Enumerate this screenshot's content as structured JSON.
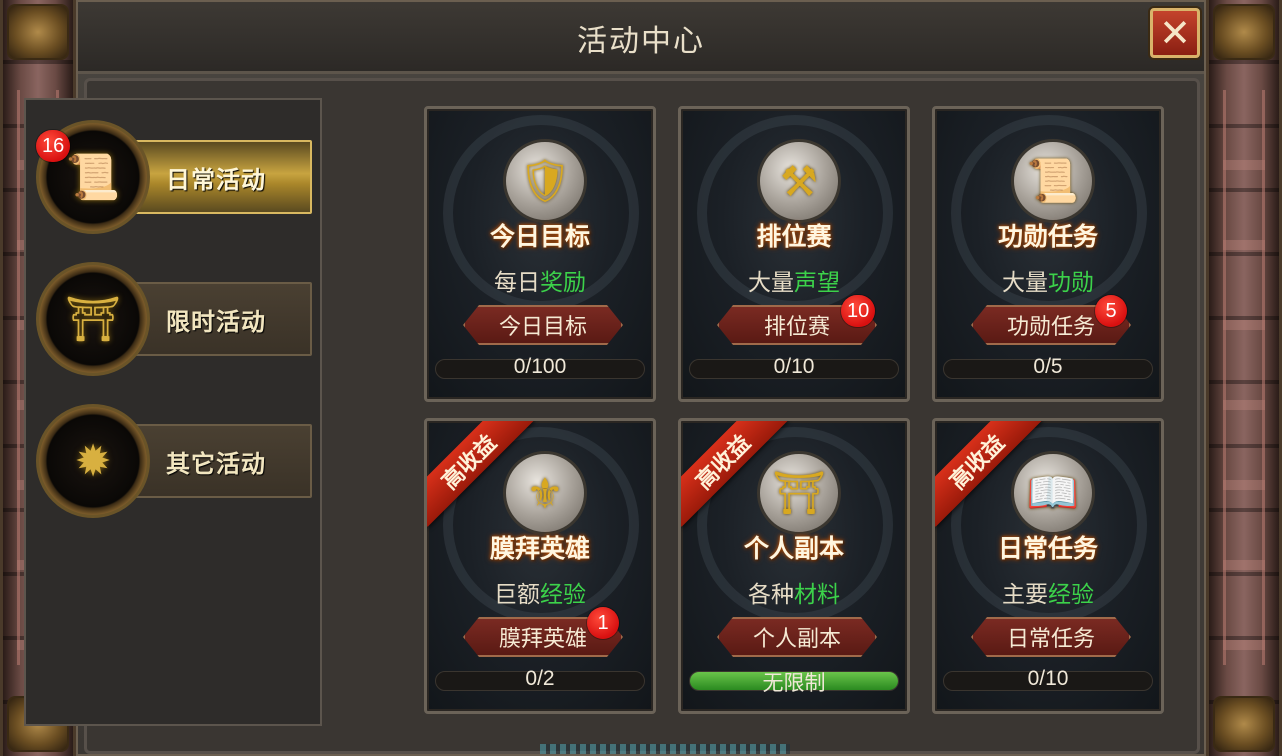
{
  "window": {
    "title": "活动中心",
    "close_icon": "close-icon"
  },
  "tabs": [
    {
      "label": "日常活动",
      "icon": "scroll-icon",
      "glyph": "📜",
      "badge": "16",
      "active": true
    },
    {
      "label": "限时活动",
      "icon": "gate-icon",
      "glyph": "⛩",
      "badge": null,
      "active": false
    },
    {
      "label": "其它活动",
      "icon": "dragon-emblem-icon",
      "glyph": "✹",
      "badge": null,
      "active": false
    }
  ],
  "cards": [
    {
      "title": "今日目标",
      "sub_plain": "每日",
      "sub_hl": "奖励",
      "button": "今日目标",
      "progress_text": "0/100",
      "progress": 0,
      "badge": null,
      "ribbon": null,
      "icon": "shield-icon",
      "glyph": "🛡"
    },
    {
      "title": "排位赛",
      "sub_plain": "大量",
      "sub_hl": "声望",
      "button": "排位赛",
      "progress_text": "0/10",
      "progress": 0,
      "badge": "10",
      "ribbon": null,
      "icon": "hammer-icon",
      "glyph": "⚒"
    },
    {
      "title": "功勋任务",
      "sub_plain": "大量",
      "sub_hl": "功勋",
      "button": "功勋任务",
      "progress_text": "0/5",
      "progress": 0,
      "badge": "5",
      "ribbon": null,
      "icon": "scroll-icon",
      "glyph": "📜"
    },
    {
      "title": "膜拜英雄",
      "sub_plain": "巨额",
      "sub_hl": "经验",
      "button": "膜拜英雄",
      "progress_text": "0/2",
      "progress": 0,
      "badge": "1",
      "ribbon": "高收益",
      "icon": "golden-helmet-icon",
      "glyph": "⚜"
    },
    {
      "title": "个人副本",
      "sub_plain": "各种",
      "sub_hl": "材料",
      "button": "个人副本",
      "progress_text": "无限制",
      "progress": 1,
      "badge": null,
      "ribbon": "高收益",
      "icon": "gate-icon",
      "glyph": "⛩"
    },
    {
      "title": "日常任务",
      "sub_plain": "主要",
      "sub_hl": "经验",
      "button": "日常任务",
      "progress_text": "0/10",
      "progress": 0,
      "badge": null,
      "ribbon": "高收益",
      "icon": "open-book-icon",
      "glyph": "📖"
    }
  ]
}
